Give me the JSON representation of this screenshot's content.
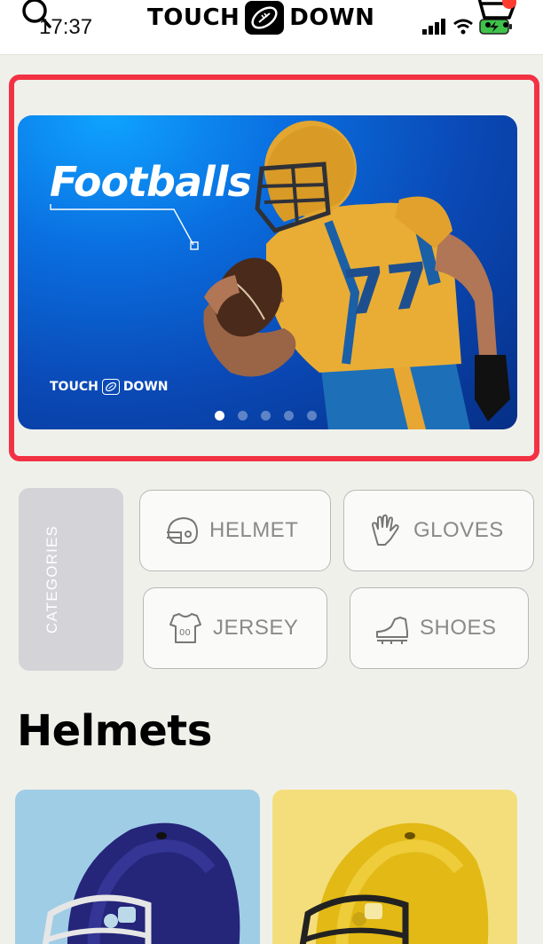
{
  "status_bar": {
    "time": "17:37"
  },
  "header": {
    "brand_left": "TOUCH",
    "brand_right": "DOWN"
  },
  "banner": {
    "title": "Footballs",
    "brand_left": "TOUCH",
    "brand_right": "DOWN",
    "slides_total": 5,
    "active_slide": 1
  },
  "categories": {
    "label": "CATEGORIES",
    "items": [
      {
        "label": "HELMET",
        "icon": "helmet-icon"
      },
      {
        "label": "GLOVES",
        "icon": "glove-icon"
      },
      {
        "label": "JERSEY",
        "icon": "jersey-icon"
      },
      {
        "label": "SHOES",
        "icon": "shoe-icon"
      }
    ]
  },
  "section": {
    "title": "Helmets"
  },
  "products": [
    {
      "color_name": "navy",
      "bg": "#9fcde6"
    },
    {
      "color_name": "yellow",
      "bg": "#f3de7b"
    }
  ],
  "colors": {
    "accent_red": "#f23244",
    "badge_red": "#ff3b30"
  }
}
